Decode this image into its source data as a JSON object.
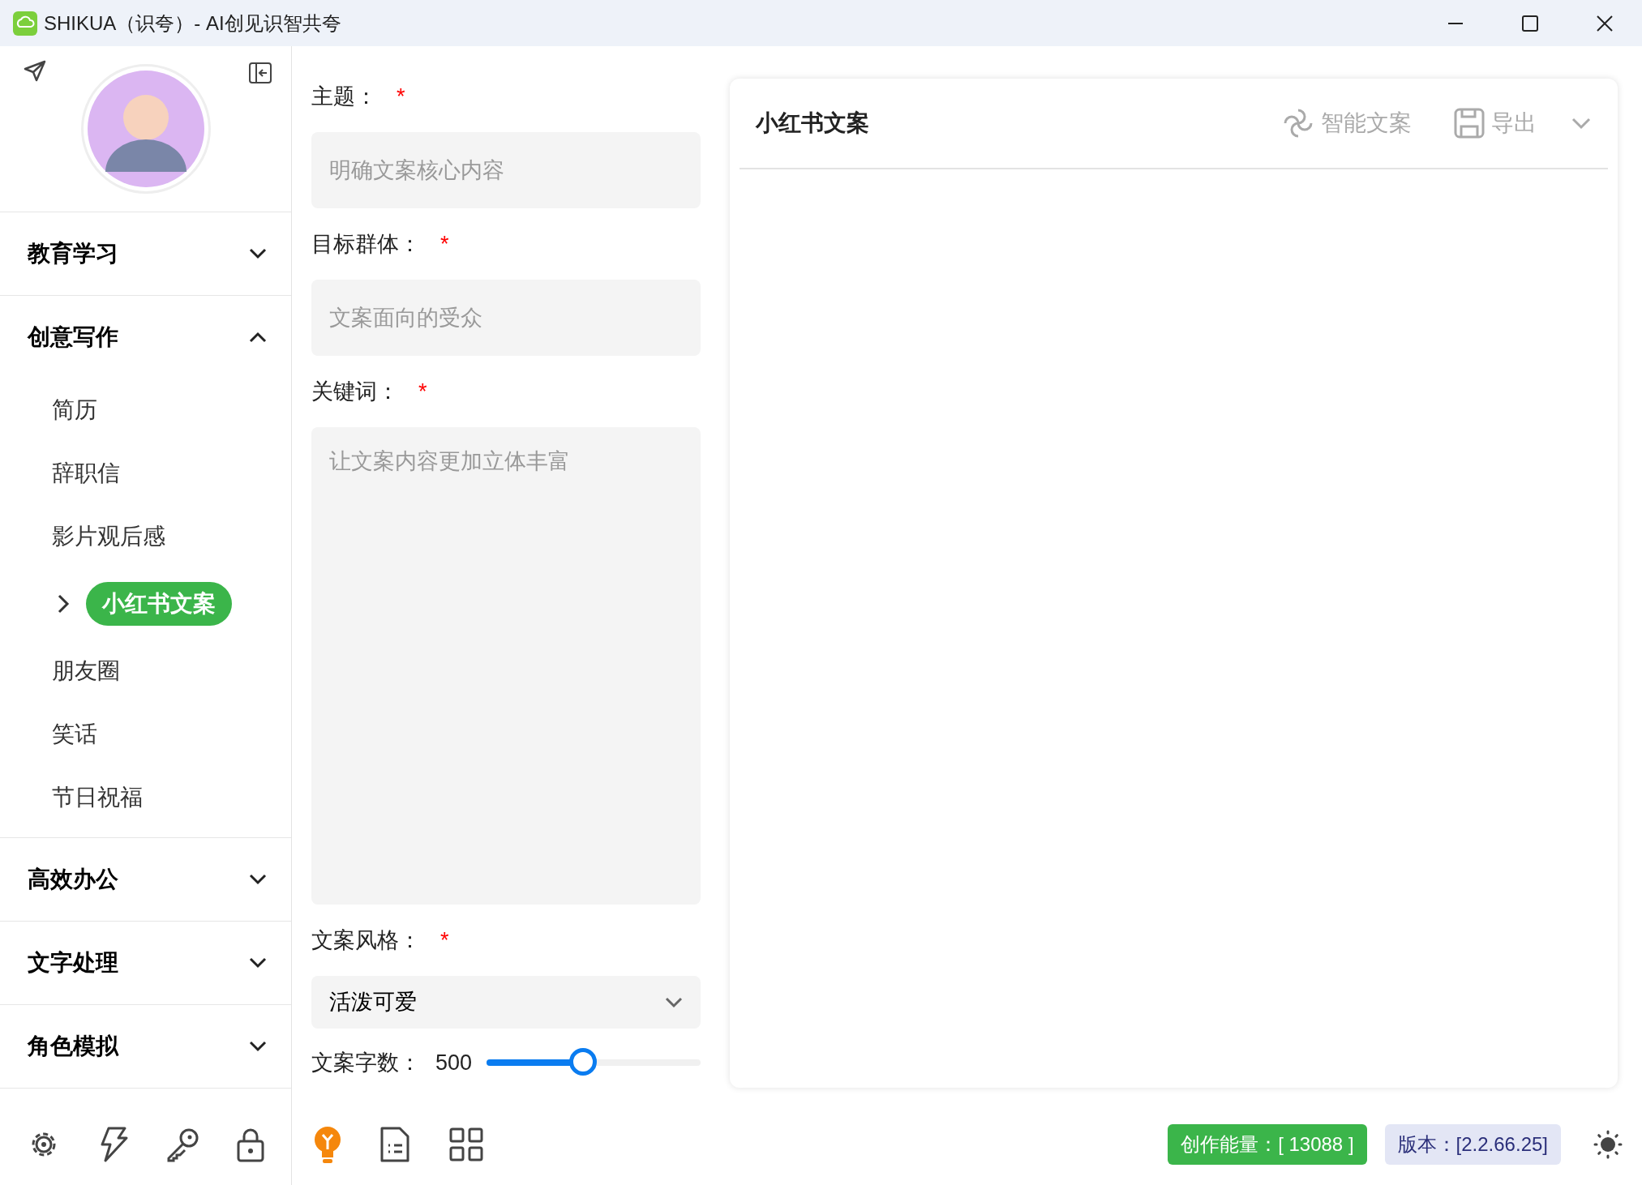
{
  "window": {
    "title": "SHIKUA（识夸）- AI创见识智共夸"
  },
  "sidebar": {
    "groups": [
      {
        "label": "教育学习",
        "expanded": false
      },
      {
        "label": "创意写作",
        "expanded": true,
        "items": [
          {
            "label": "简历",
            "selected": false
          },
          {
            "label": "辞职信",
            "selected": false
          },
          {
            "label": "影片观后感",
            "selected": false
          },
          {
            "label": "小红书文案",
            "selected": true
          },
          {
            "label": "朋友圈",
            "selected": false
          },
          {
            "label": "笑话",
            "selected": false
          },
          {
            "label": "节日祝福",
            "selected": false
          }
        ]
      },
      {
        "label": "高效办公",
        "expanded": false
      },
      {
        "label": "文字处理",
        "expanded": false
      },
      {
        "label": "角色模拟",
        "expanded": false
      }
    ]
  },
  "form": {
    "fields": [
      {
        "kind": "input",
        "label": "主题：",
        "required_mark": "*",
        "placeholder": "明确文案核心内容"
      },
      {
        "kind": "input",
        "label": "目标群体：",
        "required_mark": "*",
        "placeholder": "文案面向的受众"
      },
      {
        "kind": "textarea",
        "label": "关键词：",
        "required_mark": "*",
        "placeholder": "让文案内容更加立体丰富"
      },
      {
        "kind": "select",
        "label": "文案风格：",
        "required_mark": "*",
        "value": "活泼可爱"
      }
    ],
    "word_count": {
      "label": "文案字数：",
      "value": "500",
      "level": 0.45
    }
  },
  "panel": {
    "title": "小红书文案",
    "actions": [
      {
        "kind": "ai",
        "label": "智能文案"
      },
      {
        "kind": "save",
        "label": "导出"
      }
    ]
  },
  "status": {
    "energy": "创作能量：[ 13088 ]",
    "version": "版本：[2.2.66.25]"
  }
}
